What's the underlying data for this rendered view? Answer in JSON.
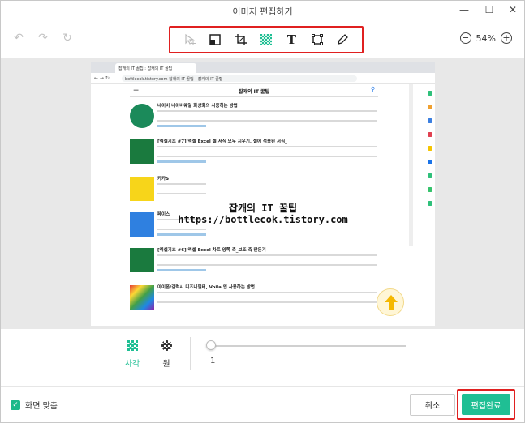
{
  "window": {
    "title": "이미지 편집하기",
    "minimize_icon": "minimize-icon",
    "maximize_icon": "maximize-icon",
    "close_icon": "close-icon"
  },
  "toolbar": {
    "undo_icon": "undo-icon",
    "redo_icon": "redo-icon",
    "reset_icon": "reset-icon",
    "tools": [
      {
        "name": "select-move-icon"
      },
      {
        "name": "mosaic-fill-icon"
      },
      {
        "name": "crop-icon"
      },
      {
        "name": "mosaic-pattern-icon"
      },
      {
        "name": "text-icon",
        "glyph": "T"
      },
      {
        "name": "rectangle-icon"
      },
      {
        "name": "pen-icon"
      }
    ],
    "zoom": "54%"
  },
  "canvas": {
    "browser_url": "bottlecok.tistory.com  잡캐의 IT 꿀팁 - 잡캐의 IT 꿀팁",
    "browser_tab": "잡캐의 IT 꿀팁 : 잡캐의 IT 꿀팁",
    "blog_title": "잡캐의 IT 꿀팁",
    "posts": [
      {
        "title": "네이버 네이버웨일 화상회의 사용하는 방법"
      },
      {
        "title": "[엑셀기초 #7] 엑셀 Excel 셀 서식 모두 지우기, 셀에 적용된 서식_"
      },
      {
        "title": "카카S"
      },
      {
        "title": "페이스"
      },
      {
        "title": "[엑셀기초 #6] 엑셀 Excel 차트 앙쪽 축_보조 축 만든기"
      },
      {
        "title": "아이폰/갤럭시 디즈니필터, Voila 앱 사용하는 방법"
      }
    ],
    "watermark_title": "잡캐의 IT 꿀팁",
    "watermark_url": "https://bottlecok.tistory.com"
  },
  "options": {
    "shape_square": "사각",
    "shape_circle": "원",
    "slider_value": "1",
    "accent": "#1fbf94"
  },
  "footer": {
    "fit_label": "화면 맞춤",
    "cancel_label": "취소",
    "done_label": "편집완료"
  }
}
